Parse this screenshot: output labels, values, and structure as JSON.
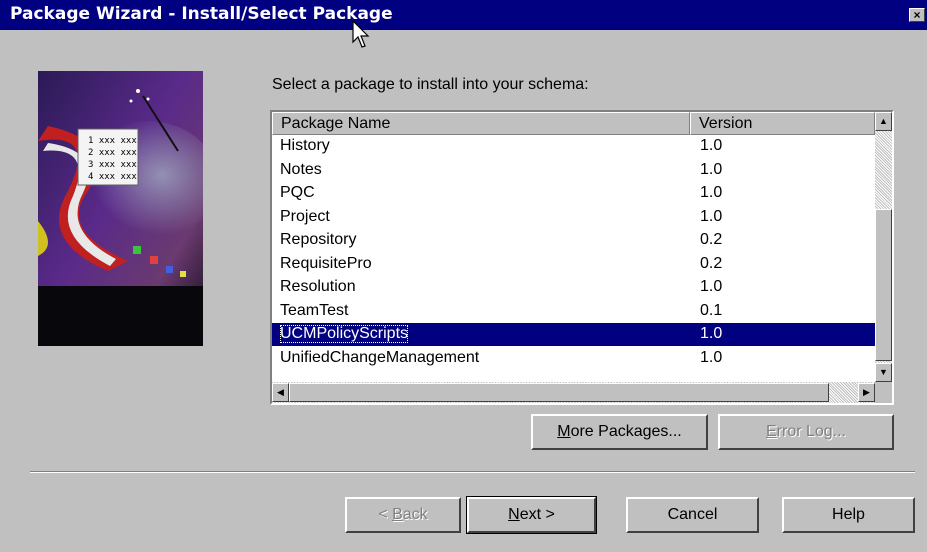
{
  "window": {
    "title": "Package Wizard - Install/Select Package",
    "close_glyph": "×"
  },
  "prompt": "Select a package to install into your schema:",
  "list": {
    "columns": [
      "Package Name",
      "Version"
    ],
    "rows": [
      {
        "name": "History",
        "version": "1.0"
      },
      {
        "name": "Notes",
        "version": "1.0"
      },
      {
        "name": "PQC",
        "version": "1.0"
      },
      {
        "name": "Project",
        "version": "1.0"
      },
      {
        "name": "Repository",
        "version": "0.2"
      },
      {
        "name": "RequisitePro",
        "version": "0.2"
      },
      {
        "name": "Resolution",
        "version": "1.0"
      },
      {
        "name": "TeamTest",
        "version": "0.1"
      },
      {
        "name": "UCMPolicyScripts",
        "version": "1.0",
        "selected": true
      },
      {
        "name": "UnifiedChangeManagement",
        "version": "1.0"
      }
    ]
  },
  "buttons": {
    "more_packages": {
      "first": "M",
      "rest": "ore Packages..."
    },
    "error_log": {
      "first": "E",
      "rest": "rror Log..."
    },
    "back": {
      "pre": "< ",
      "first": "B",
      "rest": "ack"
    },
    "next": {
      "first": "N",
      "rest": "ext >"
    },
    "cancel": "Cancel",
    "help": "Help"
  },
  "colors": {
    "titlebar": "#000080",
    "selection": "#000080",
    "face": "#c0c0c0"
  },
  "icons": {
    "close": "close-icon",
    "scroll_up": "scroll-up-icon",
    "scroll_down": "scroll-down-icon",
    "scroll_left": "scroll-left-icon",
    "scroll_right": "scroll-right-icon",
    "cursor": "mouse-pointer-icon"
  }
}
